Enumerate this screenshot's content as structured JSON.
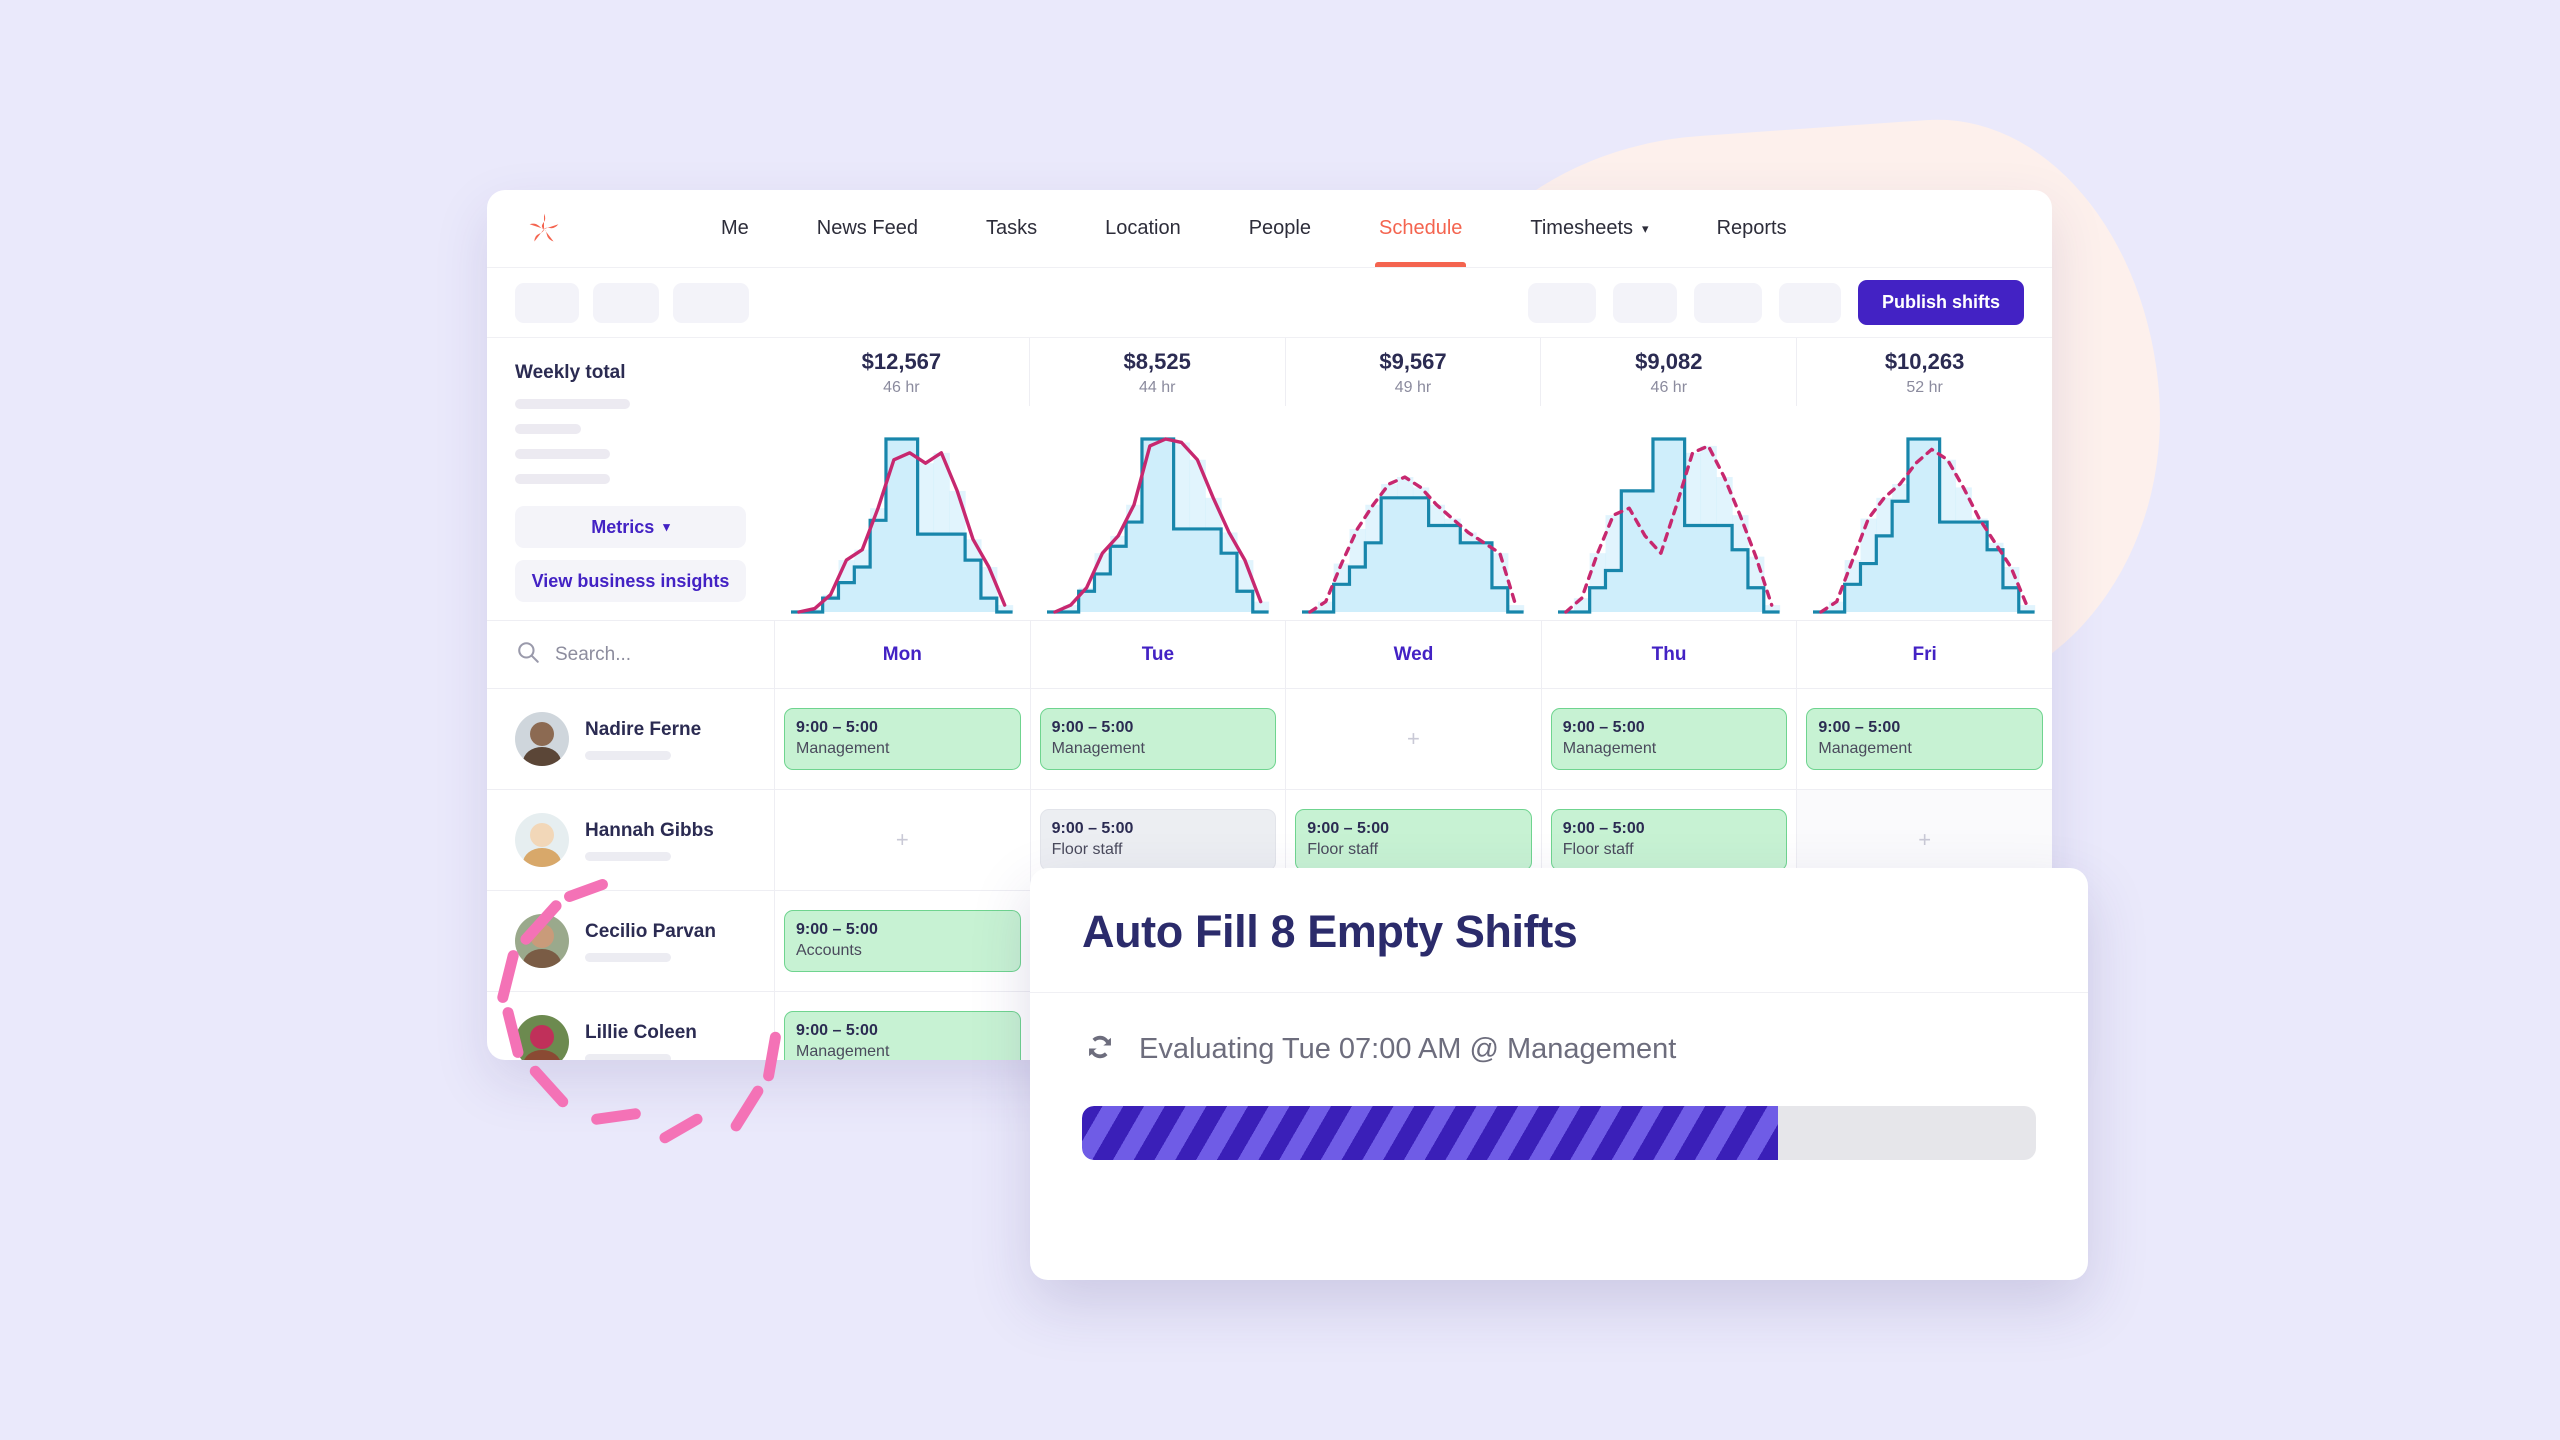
{
  "app": {
    "logo_name": "pinwheel-logo",
    "nav": [
      {
        "label": "Me",
        "active": false
      },
      {
        "label": "News Feed",
        "active": false
      },
      {
        "label": "Tasks",
        "active": false
      },
      {
        "label": "Location",
        "active": false
      },
      {
        "label": "People",
        "active": false
      },
      {
        "label": "Schedule",
        "active": true
      },
      {
        "label": "Timesheets",
        "active": false,
        "caret": "▾"
      },
      {
        "label": "Reports",
        "active": false
      }
    ]
  },
  "toolbar": {
    "publish_label": "Publish shifts",
    "left_pill_widths": [
      64,
      66,
      76
    ],
    "right_pill_widths": [
      68,
      64,
      68,
      62
    ]
  },
  "metrics": {
    "weekly_total_label": "Weekly total",
    "metrics_label": "Metrics",
    "metrics_caret": "▾",
    "insights_label": "View business insights",
    "skeleton_widths": [
      115,
      66,
      95,
      95
    ]
  },
  "schedule": {
    "search_placeholder": "Search...",
    "search_value": "",
    "search_icon": "search-icon",
    "days": [
      "Mon",
      "Tue",
      "Wed",
      "Thu",
      "Fri"
    ],
    "empty_marker": "+",
    "rows": [
      {
        "name": "Nadire Ferne",
        "avatar_colors": [
          "#cfd6dc",
          "#8c6a52",
          "#5b4637"
        ],
        "cells": [
          {
            "state": "shift",
            "style": "green",
            "time": "9:00 – 5:00",
            "role": "Management"
          },
          {
            "state": "shift",
            "style": "green",
            "time": "9:00 – 5:00",
            "role": "Management"
          },
          {
            "state": "empty",
            "style": "plain"
          },
          {
            "state": "shift",
            "style": "green",
            "time": "9:00 – 5:00",
            "role": "Management"
          },
          {
            "state": "shift",
            "style": "green",
            "time": "9:00 – 5:00",
            "role": "Management"
          }
        ]
      },
      {
        "name": "Hannah Gibbs",
        "avatar_colors": [
          "#e6eef0",
          "#f2d7b8",
          "#d8a86a"
        ],
        "cells": [
          {
            "state": "empty",
            "style": "plain"
          },
          {
            "state": "shift",
            "style": "gray",
            "time": "9:00 – 5:00",
            "role": "Floor staff"
          },
          {
            "state": "shift",
            "style": "green",
            "time": "9:00 – 5:00",
            "role": "Floor staff"
          },
          {
            "state": "shift",
            "style": "green",
            "time": "9:00 – 5:00",
            "role": "Floor staff"
          },
          {
            "state": "empty",
            "style": "muted"
          }
        ]
      },
      {
        "name": "Cecilio Parvan",
        "avatar_colors": [
          "#9aa98c",
          "#c99b7a",
          "#7a5c45"
        ],
        "cells": [
          {
            "state": "shift",
            "style": "green",
            "time": "9:00 – 5:00",
            "role": "Accounts"
          },
          {
            "state": "empty",
            "style": "plain"
          },
          {
            "state": "empty",
            "style": "plain"
          },
          {
            "state": "empty",
            "style": "plain"
          },
          {
            "state": "empty",
            "style": "plain"
          }
        ]
      },
      {
        "name": "Lillie Coleen",
        "avatar_colors": [
          "#6c8a4f",
          "#c0305a",
          "#8a4a33"
        ],
        "cells": [
          {
            "state": "shift",
            "style": "green",
            "time": "9:00 – 5:00",
            "role": "Management"
          },
          {
            "state": "empty",
            "style": "plain"
          },
          {
            "state": "empty",
            "style": "plain"
          },
          {
            "state": "empty",
            "style": "plain"
          },
          {
            "state": "empty",
            "style": "plain"
          }
        ]
      }
    ]
  },
  "modal": {
    "title": "Auto Fill 8 Empty Shifts",
    "status_icon": "refresh-icon",
    "status_text": "Evaluating Tue 07:00 AM @ Management",
    "progress_percent": 73
  },
  "colors": {
    "accent_purple": "#4322c4",
    "brand_red": "#f4644f",
    "shift_green_bg": "#c7f2d3",
    "shift_green_border": "#6fd48f",
    "shift_gray_bg": "#eceef2",
    "chart_area": "#cfeefb",
    "chart_step": "#1886ab",
    "chart_line": "#c7286f",
    "page_bg": "#eae9fb",
    "blob": "#fdf0ec",
    "burst_pink": "#f472b6",
    "progress_dark": "#3a1fb8",
    "progress_light": "#6f5ce6"
  },
  "chart_data": {
    "type": "area",
    "title": "Weekly total",
    "xlabel": "",
    "ylabel": "",
    "grid": false,
    "legend_position": "none",
    "categories": [
      "Mon",
      "Tue",
      "Wed",
      "Thu",
      "Fri"
    ],
    "panels": [
      {
        "day": "Mon",
        "total_amount": "$12,567",
        "total_hours": "46 hr",
        "amount_value": 12567,
        "hours_value": 46,
        "line_style": "solid",
        "scheduled_steps": [
          0,
          0,
          8,
          17,
          26,
          53,
          100,
          100,
          45,
          45,
          45,
          30,
          8,
          0
        ],
        "demand_curve": [
          0,
          2,
          10,
          30,
          36,
          60,
          88,
          92,
          86,
          92,
          70,
          42,
          26,
          4
        ]
      },
      {
        "day": "Tue",
        "total_amount": "$8,525",
        "total_hours": "44 hr",
        "amount_value": 8525,
        "hours_value": 44,
        "line_style": "solid",
        "scheduled_steps": [
          0,
          0,
          12,
          22,
          38,
          52,
          100,
          100,
          48,
          48,
          48,
          34,
          12,
          0
        ],
        "demand_curve": [
          0,
          4,
          14,
          34,
          44,
          62,
          96,
          100,
          98,
          88,
          66,
          46,
          30,
          6
        ]
      },
      {
        "day": "Wed",
        "total_amount": "$9,567",
        "total_hours": "49 hr",
        "amount_value": 9567,
        "hours_value": 49,
        "line_style": "dashed",
        "scheduled_steps": [
          0,
          0,
          16,
          26,
          40,
          66,
          66,
          66,
          50,
          50,
          40,
          40,
          14,
          0
        ],
        "demand_curve": [
          0,
          6,
          28,
          48,
          62,
          74,
          78,
          72,
          62,
          54,
          46,
          40,
          34,
          4
        ]
      },
      {
        "day": "Thu",
        "total_amount": "$9,082",
        "total_hours": "46 hr",
        "amount_value": 9082,
        "hours_value": 46,
        "line_style": "dashed",
        "scheduled_steps": [
          0,
          0,
          14,
          24,
          70,
          70,
          100,
          100,
          50,
          50,
          50,
          36,
          14,
          0
        ],
        "demand_curve": [
          0,
          8,
          34,
          56,
          60,
          44,
          34,
          62,
          92,
          96,
          78,
          56,
          32,
          4
        ]
      },
      {
        "day": "Fri",
        "total_amount": "$10,263",
        "total_hours": "52 hr",
        "amount_value": 10263,
        "hours_value": 52,
        "line_style": "dashed",
        "scheduled_steps": [
          0,
          0,
          16,
          28,
          44,
          64,
          100,
          100,
          52,
          52,
          52,
          36,
          14,
          0
        ],
        "demand_curve": [
          0,
          6,
          30,
          54,
          66,
          74,
          86,
          94,
          88,
          72,
          54,
          40,
          26,
          4
        ]
      }
    ]
  }
}
